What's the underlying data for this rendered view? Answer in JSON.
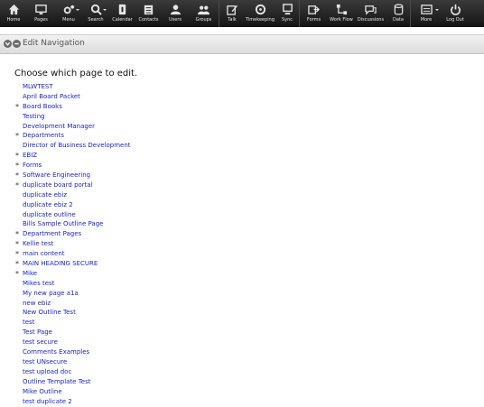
{
  "toolbar": {
    "items": [
      {
        "label": "Home",
        "icon": "home-icon"
      },
      {
        "label": "Pages",
        "icon": "monitor-icon"
      },
      {
        "label": "Menu",
        "icon": "gears-icon"
      },
      {
        "label": "Search",
        "icon": "search-icon"
      },
      {
        "label": "Calendar",
        "icon": "calendar-icon"
      },
      {
        "label": "Contacts",
        "icon": "contacts-icon"
      },
      {
        "label": "Users",
        "icon": "user-icon"
      },
      {
        "label": "Groups",
        "icon": "group-icon"
      },
      {
        "label": "Talk",
        "icon": "edit-icon"
      },
      {
        "label": "Timekeeping",
        "icon": "clock-icon"
      },
      {
        "label": "Sync",
        "icon": "sync-icon"
      },
      {
        "label": "Forms",
        "icon": "forms-icon"
      },
      {
        "label": "Work Flow",
        "icon": "workflow-icon"
      },
      {
        "label": "Discussions",
        "icon": "discussions-icon"
      },
      {
        "label": "Data",
        "icon": "database-icon"
      },
      {
        "label": "More",
        "icon": "more-icon"
      },
      {
        "label": "Log Out",
        "icon": "power-icon"
      }
    ]
  },
  "panel": {
    "title": "Edit Navigation"
  },
  "heading": "Choose which page to edit.",
  "pages": [
    {
      "label": "MLWTEST",
      "star": false
    },
    {
      "label": "April Board Packet",
      "star": false
    },
    {
      "label": "Board Books",
      "star": true
    },
    {
      "label": "Testing",
      "star": false
    },
    {
      "label": "Development Manager",
      "star": false
    },
    {
      "label": "Departments",
      "star": true
    },
    {
      "label": "Director of Business Development",
      "star": false
    },
    {
      "label": "EBIZ",
      "star": true
    },
    {
      "label": "Forms",
      "star": true
    },
    {
      "label": "Software Engineering",
      "star": true
    },
    {
      "label": "duplicate board portal",
      "star": true
    },
    {
      "label": "duplicate ebiz",
      "star": false
    },
    {
      "label": "duplicate ebiz 2",
      "star": false
    },
    {
      "label": "duplicate outline",
      "star": false
    },
    {
      "label": "Bills Sample Outline Page",
      "star": false
    },
    {
      "label": "Department Pages",
      "star": true
    },
    {
      "label": "Kellie test",
      "star": true
    },
    {
      "label": "main content",
      "star": true
    },
    {
      "label": "MAIN HEADING SECURE",
      "star": true
    },
    {
      "label": "Mike",
      "star": true
    },
    {
      "label": "Mikes test",
      "star": false
    },
    {
      "label": "My new page a1a",
      "star": false
    },
    {
      "label": "new ebiz",
      "star": false
    },
    {
      "label": "New Outline Test",
      "star": false
    },
    {
      "label": "test",
      "star": false
    },
    {
      "label": "Test Page",
      "star": false
    },
    {
      "label": "test secure",
      "star": false
    },
    {
      "label": "Comments Examples",
      "star": false
    },
    {
      "label": "test UNsecure",
      "star": false
    },
    {
      "label": "test upload doc",
      "star": false
    },
    {
      "label": "Outline Template Test",
      "star": false
    },
    {
      "label": "Mike Outline",
      "star": false
    },
    {
      "label": "test duplicate 2",
      "star": false
    }
  ],
  "colors": {
    "link": "#1a25c6",
    "toolbar": "#1c1c1c"
  }
}
